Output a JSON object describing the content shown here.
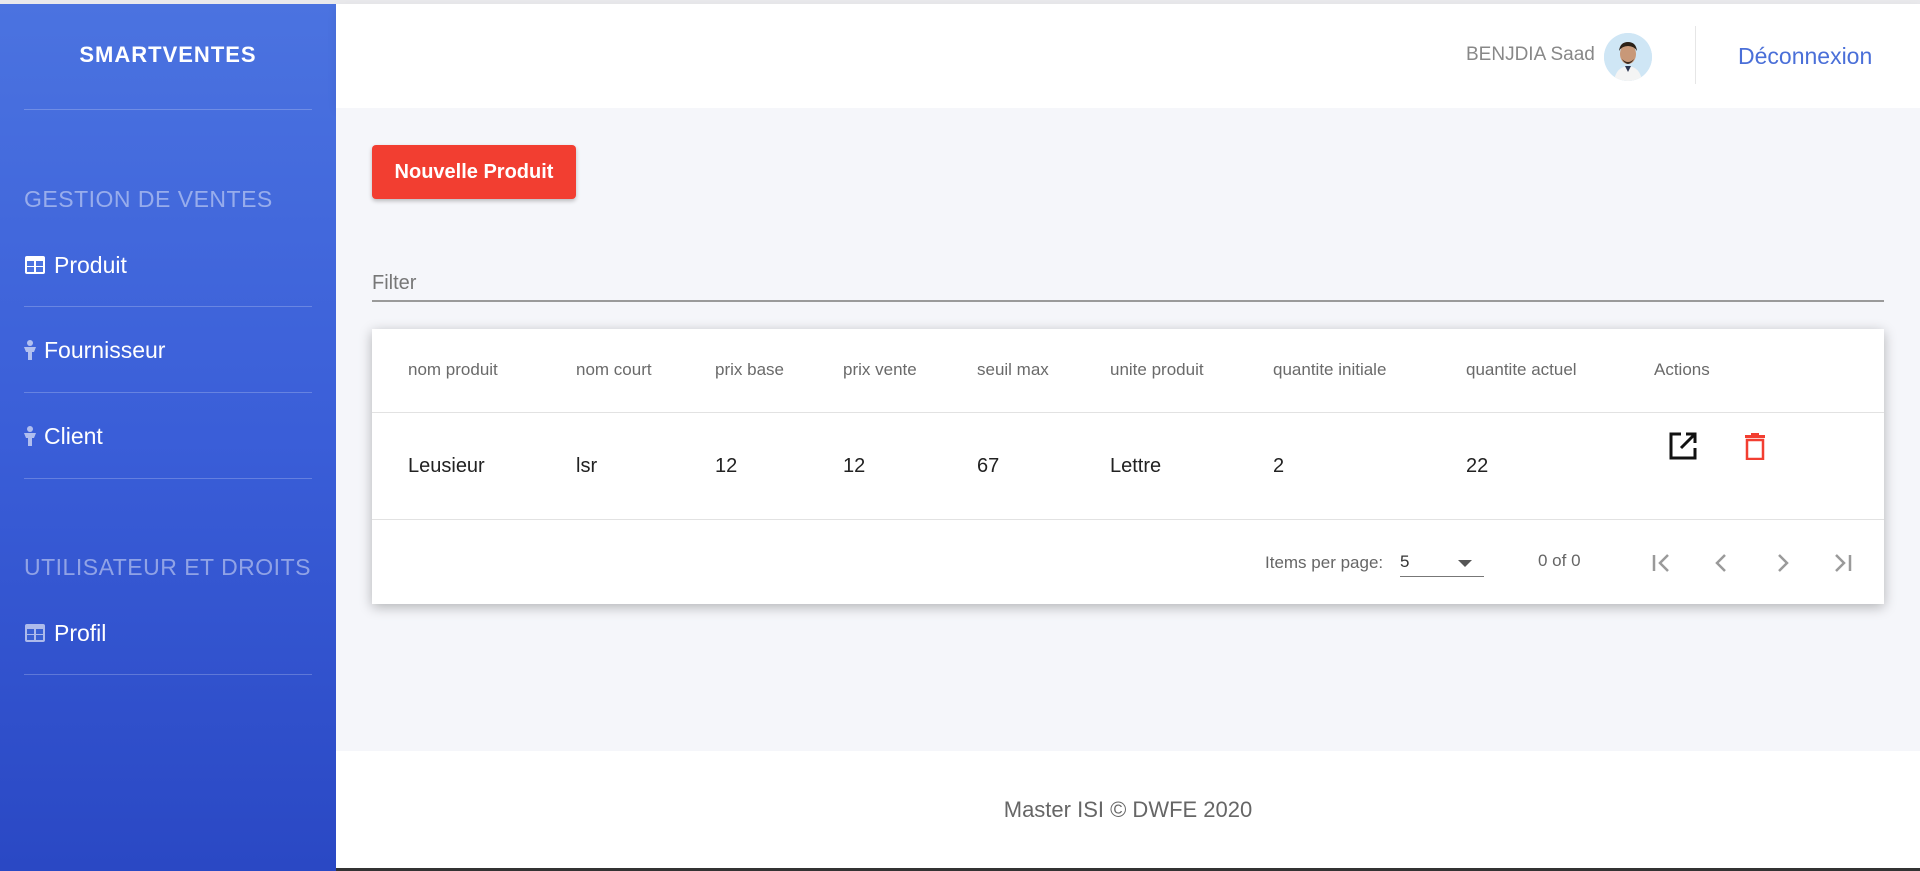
{
  "app": {
    "brand": "SMARTVENTES"
  },
  "sidebar": {
    "sections": [
      {
        "title": "GESTION DE VENTES"
      },
      {
        "title": "UTILISATEUR ET DROITS"
      }
    ],
    "items": [
      {
        "label": "Produit",
        "icon": "table-icon"
      },
      {
        "label": "Fournisseur",
        "icon": "person-icon"
      },
      {
        "label": "Client",
        "icon": "person-icon"
      },
      {
        "label": "Profil",
        "icon": "table-icon"
      }
    ]
  },
  "header": {
    "username": "BENJDIA Saad",
    "logout_label": "Déconnexion"
  },
  "toolbar": {
    "new_button_label": "Nouvelle Produit"
  },
  "filter": {
    "placeholder": "Filter",
    "value": ""
  },
  "table": {
    "columns": [
      "nom produit",
      "nom court",
      "prix base",
      "prix vente",
      "seuil max",
      "unite produit",
      "quantite initiale",
      "quantite actuel",
      "Actions"
    ],
    "rows": [
      {
        "nom_produit": "Leusieur",
        "nom_court": "lsr",
        "prix_base": "12",
        "prix_vente": "12",
        "seuil_max": "67",
        "unite_produit": "Lettre",
        "quantite_initiale": "2",
        "quantite_actuel": "22"
      }
    ],
    "action_icons": [
      "open-in-new-icon",
      "delete-icon"
    ]
  },
  "paginator": {
    "items_per_page_label": "Items per page:",
    "page_size": "5",
    "range_label": "0 of 0"
  },
  "footer": {
    "text": "Master ISI © DWFE 2020"
  },
  "colors": {
    "sidebar_top": "#4b73e0",
    "sidebar_bottom": "#2a48c4",
    "accent": "#4a6fd8",
    "danger": "#f23e31"
  }
}
